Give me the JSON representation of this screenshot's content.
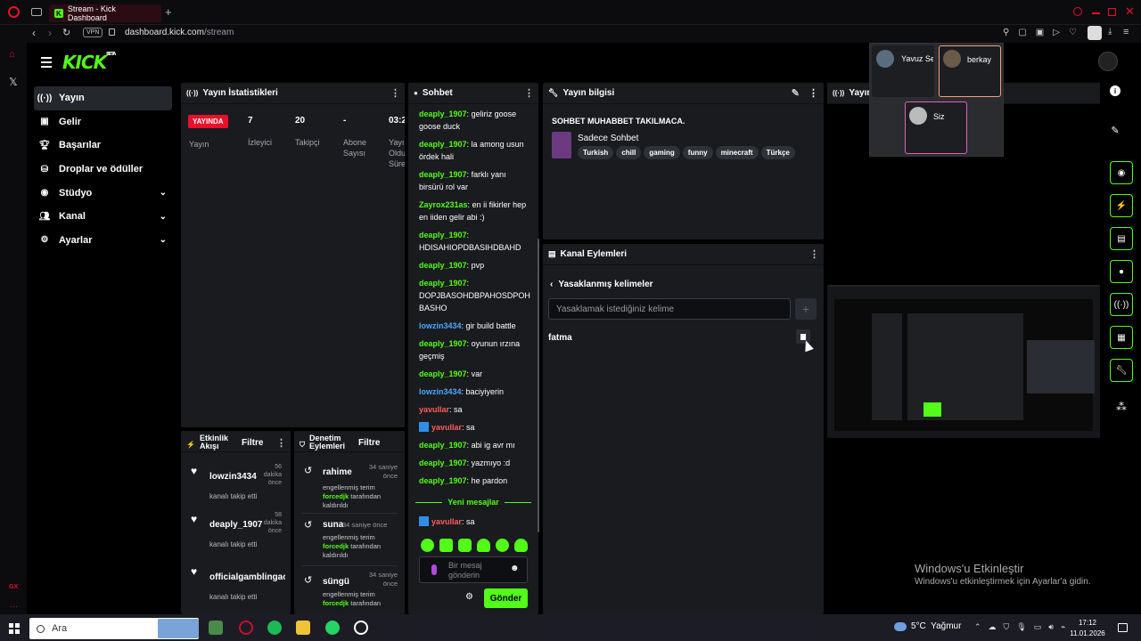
{
  "browser": {
    "tab_title": "Stream - Kick Dashboard",
    "url_host": "dashboard.kick.com",
    "url_path": "/stream",
    "vpn": "VPN"
  },
  "app": {
    "logo": "KICK",
    "logo_beta": "BETA"
  },
  "sidebar": {
    "items": [
      {
        "label": "Yayın"
      },
      {
        "label": "Gelir"
      },
      {
        "label": "Başarılar"
      },
      {
        "label": "Droplar ve ödüller"
      },
      {
        "label": "Stüdyo"
      },
      {
        "label": "Kanal"
      },
      {
        "label": "Ayarlar"
      }
    ]
  },
  "stats": {
    "title": "Yayın İstatistikleri",
    "live_badge": "YAYINDA",
    "live_label": "Yayın",
    "items": [
      {
        "value": "7",
        "label": "İzleyici"
      },
      {
        "value": "20",
        "label": "Takipçi"
      },
      {
        "value": "-",
        "label": "Abone Sayısı"
      },
      {
        "value": "03:2",
        "label": "Yayı Oldu Süre"
      }
    ]
  },
  "activity": {
    "title": "Etkinlik Akışı",
    "filter": "Filtre",
    "items": [
      {
        "user": "lowzin3434",
        "time": "56 dakika önce",
        "desc": "kanalı takip etti"
      },
      {
        "user": "deaply_1907",
        "time": "58 dakika önce",
        "desc": "kanalı takip etti"
      },
      {
        "user": "officialgamblingac",
        "time": "",
        "desc": "kanalı takip etti"
      }
    ]
  },
  "moderation": {
    "title": "Denetim Eylemleri",
    "filter": "Filtre",
    "items": [
      {
        "user": "rahime",
        "time": "34 saniye önce",
        "line1": "engellenmiş terim",
        "by": "forcedjk",
        "line2": "tarafından",
        "line3": "kaldırıldı"
      },
      {
        "user": "suna",
        "time": "34 saniye önce",
        "line1": "engellenmiş terim",
        "by": "forcedjk",
        "line2": "tarafından",
        "line3": "kaldırıldı"
      },
      {
        "user": "süngü",
        "time": "34 saniye önce",
        "line1": "engellenmiş terim",
        "by": "forcedjk",
        "line2": "tarafından",
        "line3": ""
      }
    ]
  },
  "chat": {
    "title": "Sohbet",
    "messages": [
      {
        "user": "deaply_1907",
        "color": "g",
        "text": "geliriz goose goose duck"
      },
      {
        "user": "deaply_1907",
        "color": "g",
        "text": "la among usun ördek hali"
      },
      {
        "user": "deaply_1907",
        "color": "g",
        "text": "farklı yanı birsürü rol var"
      },
      {
        "user": "Zayrox231as",
        "color": "g",
        "text": "en ii fikirler hep en iiden gelir abi :)"
      },
      {
        "user": "deaply_1907",
        "color": "g",
        "text": "HDISAHIOPDBASIHDBAHD"
      },
      {
        "user": "deaply_1907",
        "color": "g",
        "text": "pvp"
      },
      {
        "user": "deaply_1907",
        "color": "g",
        "text": "DOPJBASOHDBPAHOSDPOH BASHO"
      },
      {
        "user": "lowzin3434",
        "color": "b",
        "text": "gir build battle"
      },
      {
        "user": "deaply_1907",
        "color": "g",
        "text": "oyunun ırzına geçmiş"
      },
      {
        "user": "deaply_1907",
        "color": "g",
        "text": "var"
      },
      {
        "user": "lowzin3434",
        "color": "b",
        "text": "baciyiyerin"
      },
      {
        "user": "yavullar",
        "color": "r",
        "text": "sa"
      },
      {
        "user": "yavullar",
        "color": "r",
        "text": "sa",
        "badge": true
      },
      {
        "user": "deaply_1907",
        "color": "g",
        "text": "abi ig avr mı"
      },
      {
        "user": "deaply_1907",
        "color": "g",
        "text": "yazmıyo :d"
      },
      {
        "user": "deaply_1907",
        "color": "g",
        "text": "he pardon"
      }
    ],
    "new_messages": "Yeni mesajlar",
    "last": {
      "user": "yavullar",
      "text": "sa"
    },
    "input_placeholder": "Bir mesaj gönderin",
    "send": "Gönder"
  },
  "stream_info": {
    "title": "Yayın bilgisi",
    "stream_title": "SOHBET MUHABBET TAKILMACA.",
    "category": "Sadece Sohbet",
    "tags": [
      "Turkish",
      "chill",
      "gaming",
      "funny",
      "minecraft",
      "Türkçe"
    ]
  },
  "channel_actions": {
    "title": "Kanal Eylemleri",
    "section": "Yasaklanmış kelimeler",
    "input_placeholder": "Yasaklamak istediğiniz kelime",
    "words": [
      "fatma"
    ]
  },
  "preview": {
    "title": "Yayın Ö"
  },
  "call": {
    "participants": [
      "Yavuz Se",
      "berkay",
      "Siz"
    ]
  },
  "watermark": {
    "line1": "Windows'u Etkinleştir",
    "line2": "Windows'u etkinleştirmek için Ayarlar'a gidin."
  },
  "taskbar": {
    "search": "Ara",
    "weather": "5°C  Yağmur",
    "time": "17:12",
    "date": "11.01.2026"
  },
  "colors": {
    "accent": "#53fc18",
    "live": "#e8102b",
    "panel": "#191b1f"
  }
}
